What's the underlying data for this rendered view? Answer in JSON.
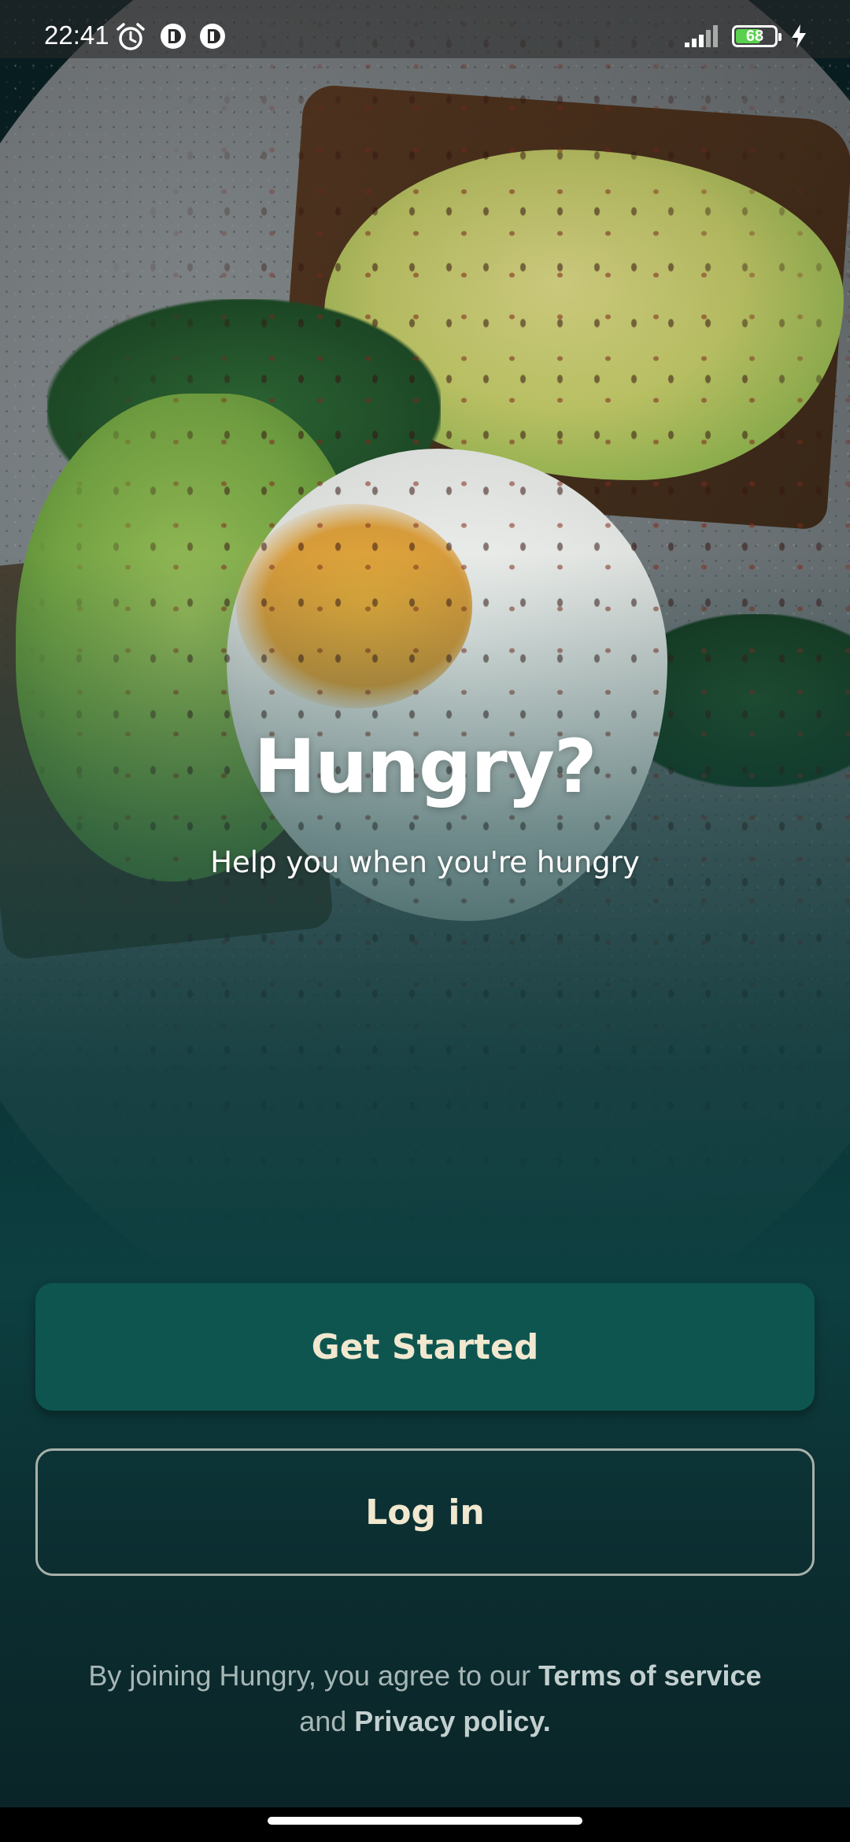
{
  "status_bar": {
    "time": "22:41",
    "battery_level": "68",
    "battery_fraction": 0.68,
    "icons": [
      "alarm-icon",
      "app-icon",
      "app-icon",
      "signal-icon",
      "battery-icon",
      "charging-bolt-icon"
    ]
  },
  "hero": {
    "image": "avocado-toast-poached-egg-photo",
    "title": "Hungry?",
    "subtitle": "Help you when you're hungry"
  },
  "actions": {
    "get_started_label": "Get Started",
    "login_label": "Log in"
  },
  "legal": {
    "prefix": "By joining Hungry, you agree to our ",
    "terms_label": "Terms of service",
    "middle": "and ",
    "privacy_label": "Privacy policy."
  },
  "colors": {
    "primary_button": "#0e5550",
    "button_text": "#f1e8cf",
    "background_dark": "#0a2226"
  }
}
